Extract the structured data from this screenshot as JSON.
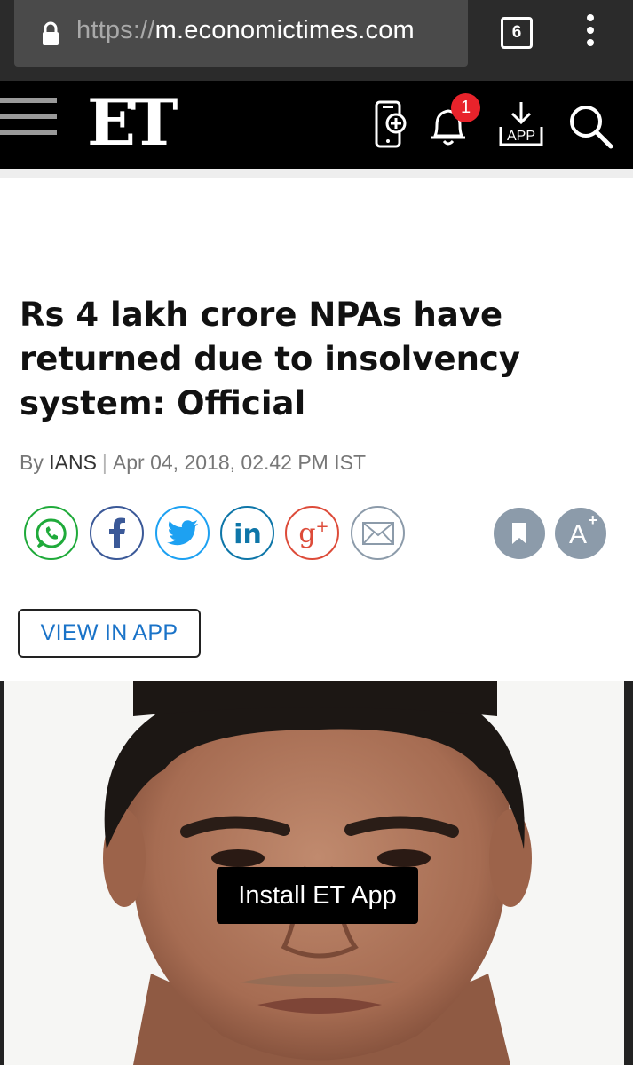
{
  "browser": {
    "url_scheme": "https://",
    "url_host": "m.economictimes.com",
    "tab_count": "6"
  },
  "header": {
    "logo": "ET",
    "notification_count": "1",
    "app_label": "APP"
  },
  "article": {
    "headline": "Rs 4 lakh crore NPAs have returned due to insolvency system: Official",
    "by_prefix": "By",
    "author": "IANS",
    "separator": "|",
    "date": "Apr 04, 2018, 02.42 PM IST"
  },
  "share": [
    {
      "name": "whatsapp-icon",
      "color": "#1faa3a"
    },
    {
      "name": "facebook-icon",
      "color": "#3b5998"
    },
    {
      "name": "twitter-icon",
      "color": "#1da1f2"
    },
    {
      "name": "linkedin-icon",
      "color": "#0e76a8"
    },
    {
      "name": "googleplus-icon",
      "color": "#dd4b39"
    },
    {
      "name": "email-icon",
      "color": "#8c9baa"
    }
  ],
  "actions": {
    "font_label": "A",
    "font_plus": "+"
  },
  "view_in_app_label": "VIEW IN APP",
  "install_label": "Install ET App"
}
